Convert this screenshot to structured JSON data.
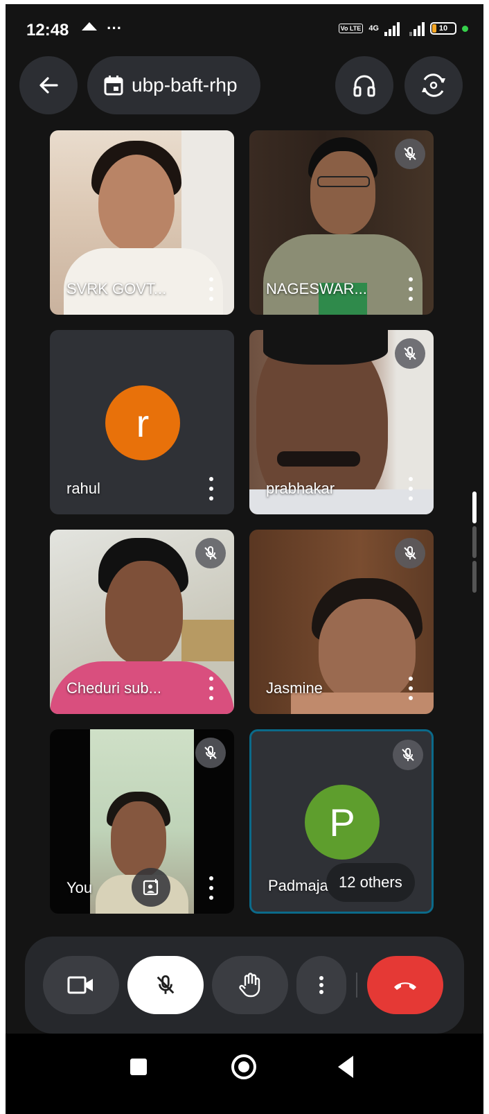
{
  "status_bar": {
    "time": "12:48",
    "network": "4G",
    "volte": "Vo LTE",
    "battery": "10",
    "battery_color": "#f5a623",
    "indicator_color": "#36d04b"
  },
  "top_bar": {
    "meeting_code": "ubp-baft-rhp",
    "back_icon": "arrow-left-icon",
    "calendar_icon": "calendar-icon",
    "audio_icon": "headphones-icon",
    "switch_camera_icon": "switch-camera-icon"
  },
  "participants": [
    {
      "name": "SVRK GOVT...",
      "muted": false,
      "video": true
    },
    {
      "name": "NAGESWAR...",
      "muted": true,
      "video": true
    },
    {
      "name": "rahul",
      "muted": false,
      "video": false,
      "avatar_letter": "r",
      "avatar_color": "#e8710a"
    },
    {
      "name": "prabhakar",
      "muted": true,
      "video": true
    },
    {
      "name": "Cheduri sub...",
      "muted": true,
      "video": true
    },
    {
      "name": "Jasmine",
      "muted": true,
      "video": true
    },
    {
      "name": "You",
      "muted": true,
      "video": true
    },
    {
      "name": "Padmaja",
      "muted": true,
      "video": false,
      "avatar_letter": "P",
      "avatar_color": "#5e9e2d",
      "others_label": "12 others",
      "highlight_color": "#0b6a8a"
    }
  ],
  "controls": {
    "camera_icon": "camera-icon",
    "mic_icon": "mic-off-icon",
    "raise_hand_icon": "hand-icon",
    "more_icon": "more-vert-icon",
    "end_call_icon": "end-call-icon",
    "end_call_color": "#e53935"
  },
  "nav": {
    "recents_icon": "square-icon",
    "home_icon": "circle-icon",
    "back_icon": "triangle-back-icon"
  }
}
